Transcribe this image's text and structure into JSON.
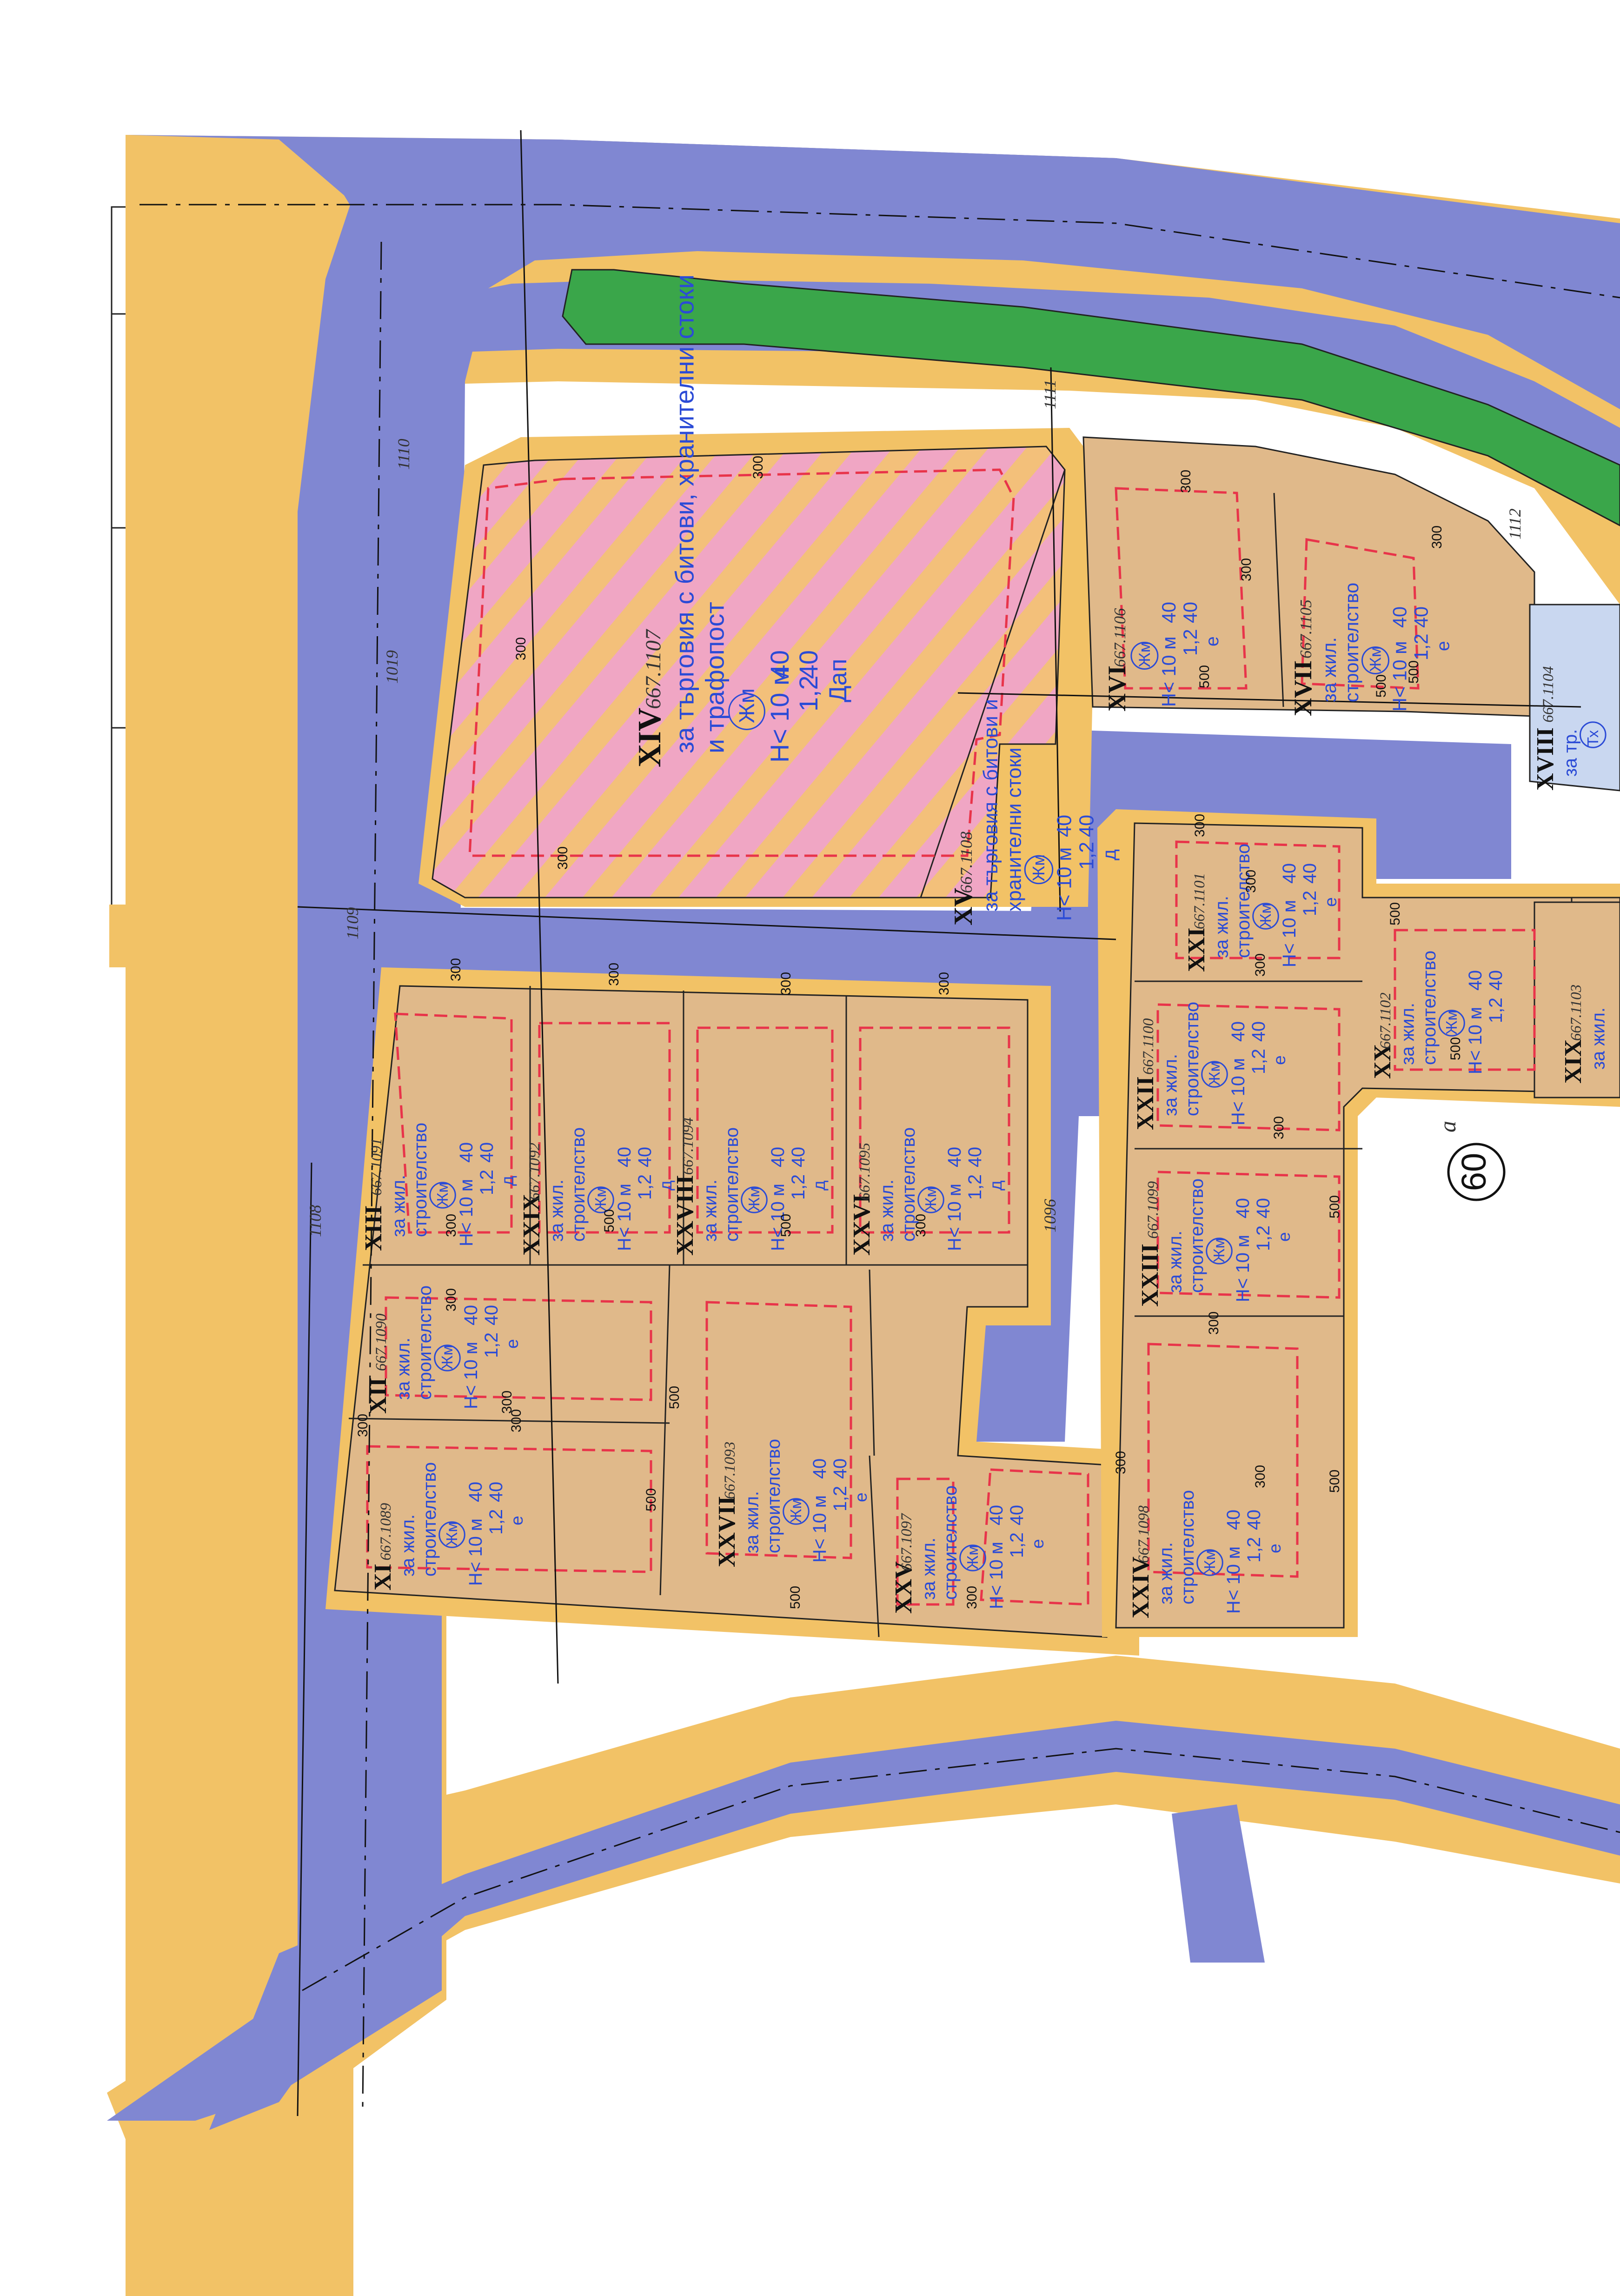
{
  "colors": {
    "road": "#8087d2",
    "sidewalk": "#f2c266",
    "plot": "#e0b98a",
    "green": "#3aa64a",
    "commercial_pink": "#f0a6c4",
    "commercial_stripe": "#f3c07a",
    "regulation_line": "#e8344a",
    "label_blue": "#2b4bd6",
    "tech_zone": "#c9d7f0"
  },
  "quarter_label": {
    "number": "60",
    "suffix": "а"
  },
  "street_ids": [
    "1110",
    "1019",
    "1109",
    "1108",
    "1096",
    "1111",
    "1112"
  ],
  "plots": [
    {
      "id": "XIV",
      "cadastral": "667.1107",
      "purpose": [
        "за търговия с битови, хранителни стоки",
        "и трафопост"
      ],
      "zone": "Жм",
      "height": "Н< 10 м",
      "density": "40",
      "kint": "1,2",
      "green_pct": "40",
      "mark": "Дап"
    },
    {
      "id": "XV",
      "cadastral": "667.1108",
      "purpose": [
        "за търговия с битови и",
        "хранителни стоки"
      ],
      "zone": "Жм",
      "height": "Н< 10 м",
      "density": "40",
      "kint": "1,2",
      "green_pct": "40",
      "mark": "д"
    },
    {
      "id": "XVI",
      "cadastral": "667.1106",
      "purpose": [],
      "zone": "Жм",
      "height": "Н< 10 м",
      "density": "40",
      "kint": "1,2",
      "green_pct": "40",
      "mark": "е"
    },
    {
      "id": "XVII",
      "cadastral": "667.1105",
      "purpose": [
        "за жил.",
        "строителство"
      ],
      "zone": "Жм",
      "height": "Н< 10 м",
      "density": "40",
      "kint": "1,2",
      "green_pct": "40",
      "mark": "е"
    },
    {
      "id": "XVIII",
      "cadastral": "667.1104",
      "purpose": [
        "за тр."
      ],
      "zone": "Тх",
      "height": "",
      "density": "",
      "kint": "",
      "green_pct": "",
      "mark": ""
    },
    {
      "id": "XIX",
      "cadastral": "667.1103",
      "purpose": [
        "за жил."
      ],
      "zone": "",
      "height": "",
      "density": "",
      "kint": "",
      "green_pct": "",
      "mark": ""
    },
    {
      "id": "XX",
      "cadastral": "667.1102",
      "purpose": [
        "за жил.",
        "строителство"
      ],
      "zone": "Жм",
      "height": "Н< 10 м",
      "density": "40",
      "kint": "1,2",
      "green_pct": "40",
      "mark": ""
    },
    {
      "id": "XXI",
      "cadastral": "667.1101",
      "purpose": [
        "за жил.",
        "строителство"
      ],
      "zone": "Жм",
      "height": "Н< 10 м",
      "density": "40",
      "kint": "1,2",
      "green_pct": "40",
      "mark": "е"
    },
    {
      "id": "XXII",
      "cadastral": "667.1100",
      "purpose": [
        "за жил.",
        "строителство"
      ],
      "zone": "Жм",
      "height": "Н< 10 м",
      "density": "40",
      "kint": "1,2",
      "green_pct": "40",
      "mark": "е"
    },
    {
      "id": "XXIII",
      "cadastral": "667.1099",
      "purpose": [
        "за жил.",
        "строителство"
      ],
      "zone": "Жм",
      "height": "Н< 10 м",
      "density": "40",
      "kint": "1,2",
      "green_pct": "40",
      "mark": "е"
    },
    {
      "id": "XXIV",
      "cadastral": "667.1098",
      "purpose": [
        "за жил.",
        "строителство"
      ],
      "zone": "Жм",
      "height": "Н< 10 м",
      "density": "40",
      "kint": "1,2",
      "green_pct": "40",
      "mark": "е"
    },
    {
      "id": "XXV",
      "cadastral": "667.1097",
      "purpose": [
        "за жил.",
        "строителство"
      ],
      "zone": "Жм",
      "height": "Н< 10 м",
      "density": "40",
      "kint": "1,2",
      "green_pct": "40",
      "mark": "е"
    },
    {
      "id": "XXVI",
      "cadastral": "667.1095",
      "purpose": [
        "за жил.",
        "строителство"
      ],
      "zone": "Жм",
      "height": "Н< 10 м",
      "density": "40",
      "kint": "1,2",
      "green_pct": "40",
      "mark": "д"
    },
    {
      "id": "XXVII",
      "cadastral": "667.1093",
      "purpose": [
        "за жил.",
        "строителство"
      ],
      "zone": "Жм",
      "height": "Н< 10 м",
      "density": "40",
      "kint": "1,2",
      "green_pct": "40",
      "mark": "е"
    },
    {
      "id": "XXVIII",
      "cadastral": "667.1094",
      "purpose": [
        "за жил.",
        "строителство"
      ],
      "zone": "Жм",
      "height": "Н< 10 м",
      "density": "40",
      "kint": "1,2",
      "green_pct": "40",
      "mark": "д"
    },
    {
      "id": "XXIX",
      "cadastral": "667.1092",
      "purpose": [
        "за жил.",
        "строителство"
      ],
      "zone": "Жм",
      "height": "Н< 10 м",
      "density": "40",
      "kint": "1,2",
      "green_pct": "40",
      "mark": "д"
    },
    {
      "id": "XIII",
      "cadastral": "667.1091",
      "purpose": [
        "за жил.",
        "строителство"
      ],
      "zone": "Жм",
      "height": "Н< 10 м",
      "density": "40",
      "kint": "1,2",
      "green_pct": "40",
      "mark": "д"
    },
    {
      "id": "XII",
      "cadastral": "667.1090",
      "purpose": [
        "за жил.",
        "строителство"
      ],
      "zone": "Жм",
      "height": "Н< 10 м",
      "density": "40",
      "kint": "1,2",
      "green_pct": "40",
      "mark": "е"
    },
    {
      "id": "XI",
      "cadastral": "667.1089",
      "purpose": [
        "за жил.",
        "строителство"
      ],
      "zone": "Жм",
      "height": "Н< 10 м",
      "density": "40",
      "kint": "1,2",
      "green_pct": "40",
      "mark": "е"
    }
  ],
  "setbacks": [
    "300",
    "500"
  ]
}
